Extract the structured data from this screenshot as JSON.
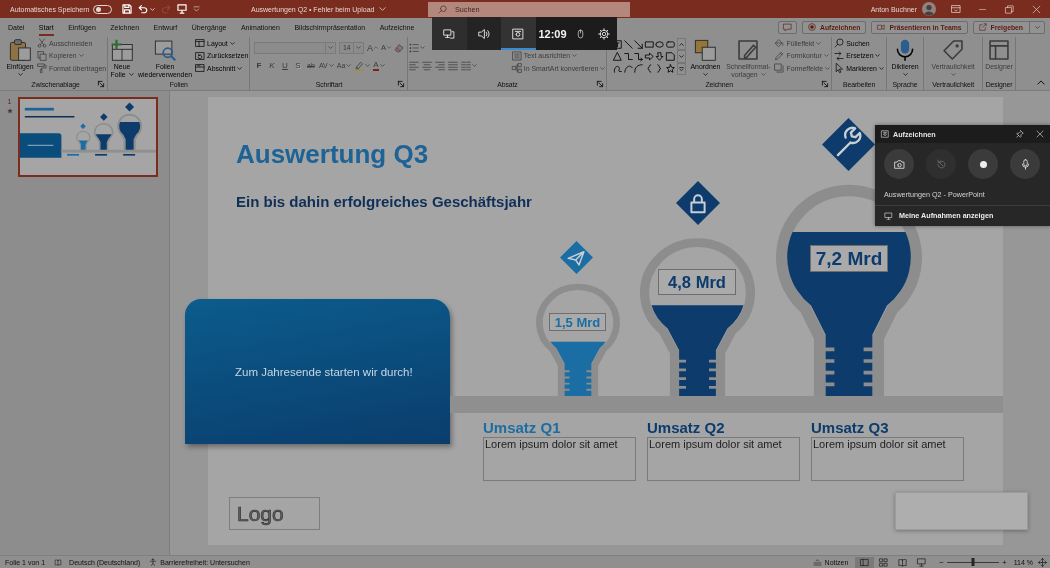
{
  "title_bar": {
    "autosave": {
      "label": "Automatisches Speichern",
      "on": false
    },
    "quick_access": [
      {
        "disabled": false
      },
      {
        "disabled": false
      },
      {
        "disabled": true
      },
      {
        "disabled": false
      }
    ],
    "document_title": "Auswertungen Q2 • Fehler beim Upload",
    "search": {
      "placeholder": "Suchen"
    },
    "user": "Anton Buchner"
  },
  "tabs": [
    {
      "label": "Datei",
      "selected": false
    },
    {
      "label": "Start",
      "selected": true
    },
    {
      "label": "Einfügen",
      "selected": false
    },
    {
      "label": "Zeichnen",
      "selected": false
    },
    {
      "label": "Entwurf",
      "selected": false
    },
    {
      "label": "Übergänge",
      "selected": false
    },
    {
      "label": "Animationen",
      "selected": false
    },
    {
      "label": "Bildschirmpräsentation",
      "selected": false
    },
    {
      "label": "Aufzeichne",
      "selected": false
    }
  ],
  "tab_actions": [
    {
      "label": "Aufzeichnen",
      "menu": false
    },
    {
      "label": "Präsentieren in Teams",
      "menu": false
    },
    {
      "label": "Freigeben",
      "menu": true
    }
  ],
  "ribbon": {
    "groups": [
      {
        "label": "Zwischenablage",
        "launcher": true,
        "items": [
          {
            "kind": "large",
            "label": "Einfügen",
            "menu": true,
            "disabled": false
          },
          {
            "kind": "small",
            "label": "Ausschneiden",
            "menu": false,
            "disabled": true
          },
          {
            "kind": "small",
            "label": "Kopieren",
            "menu": true,
            "disabled": true
          },
          {
            "kind": "small",
            "label": "Format übertragen",
            "menu": false,
            "disabled": true
          }
        ]
      },
      {
        "label": "Folien",
        "launcher": false,
        "items": [
          {
            "kind": "large",
            "label": "Neue Folie",
            "menu": true,
            "disabled": false
          },
          {
            "kind": "large",
            "label": "Folien wiederverwenden",
            "menu": false,
            "disabled": false
          },
          {
            "kind": "small",
            "label": "Layout",
            "menu": true,
            "disabled": false
          },
          {
            "kind": "small",
            "label": "Zurücksetzen",
            "menu": false,
            "disabled": false
          },
          {
            "kind": "small",
            "label": "Abschnitt",
            "menu": true,
            "disabled": false
          }
        ]
      },
      {
        "label": "Schriftart",
        "launcher": true,
        "items": [
          {
            "kind": "toolrow",
            "tools": [
              {
                "kind": "combo",
                "menu": true,
                "disabled": true
              },
              {
                "kind": "combo",
                "value": "14",
                "menu": true,
                "disabled": true
              },
              {
                "kind": "tool",
                "label": "A",
                "menu": false,
                "disabled": true
              },
              {
                "kind": "tool",
                "label": "A",
                "menu": false,
                "disabled": true
              },
              {
                "kind": "tool",
                "menu": false,
                "disabled": true
              }
            ]
          },
          {
            "kind": "toolrow",
            "tools": [
              {
                "kind": "tool",
                "label": "F",
                "menu": false,
                "disabled": true
              },
              {
                "kind": "tool",
                "label": "K",
                "menu": false,
                "disabled": true
              },
              {
                "kind": "tool",
                "label": "U",
                "menu": false,
                "disabled": true
              },
              {
                "kind": "tool",
                "label": "S",
                "menu": false,
                "disabled": true
              },
              {
                "kind": "tool",
                "label": "ab",
                "menu": false,
                "disabled": true
              },
              {
                "kind": "tool",
                "label": "AV",
                "menu": true,
                "disabled": true
              },
              {
                "kind": "tool",
                "label": "Aa",
                "menu": true,
                "disabled": true
              },
              {
                "kind": "tool",
                "menu": true,
                "disabled": true
              },
              {
                "kind": "tool",
                "label": "A",
                "menu": true,
                "disabled": true
              }
            ]
          }
        ]
      },
      {
        "label": "Absatz",
        "launcher": true,
        "items": [
          {
            "kind": "toolrow",
            "tools": [
              {
                "kind": "tool",
                "menu": true,
                "disabled": true
              }
            ]
          },
          {
            "kind": "toolrow",
            "tools": [
              {
                "kind": "tool",
                "menu": false,
                "disabled": true
              },
              {
                "kind": "tool",
                "menu": false,
                "disabled": true
              },
              {
                "kind": "tool",
                "menu": false,
                "disabled": true
              },
              {
                "kind": "tool",
                "menu": false,
                "disabled": true
              },
              {
                "kind": "tool",
                "menu": true,
                "disabled": true
              }
            ]
          },
          {
            "kind": "small",
            "label": "Text ausrichten",
            "menu": true,
            "disabled": true
          },
          {
            "kind": "small",
            "label": "In SmartArt konvertieren",
            "menu": true,
            "disabled": true
          }
        ]
      },
      {
        "label": "Zeichnen",
        "launcher": true,
        "items": [
          {
            "kind": "gallery"
          },
          {
            "kind": "large",
            "label": "Anordnen",
            "menu": true,
            "disabled": false
          },
          {
            "kind": "large",
            "label": "Schnellformat-vorlagen",
            "menu": true,
            "disabled": true
          },
          {
            "kind": "small",
            "label": "Fülleffekt",
            "menu": true,
            "disabled": true
          },
          {
            "kind": "small",
            "label": "Formkontur",
            "menu": true,
            "disabled": true
          },
          {
            "kind": "small",
            "label": "Formeffekte",
            "menu": true,
            "disabled": true
          }
        ]
      },
      {
        "label": "Bearbeiten",
        "launcher": false,
        "items": [
          {
            "kind": "small",
            "label": "Suchen",
            "menu": false,
            "disabled": false
          },
          {
            "kind": "small",
            "label": "Ersetzen",
            "menu": true,
            "disabled": false
          },
          {
            "kind": "small",
            "label": "Markieren",
            "menu": true,
            "disabled": false
          }
        ]
      },
      {
        "label": "Sprache",
        "launcher": false,
        "items": [
          {
            "kind": "large",
            "label": "Diktieren",
            "menu": true,
            "disabled": false
          }
        ]
      },
      {
        "label": "Vertraulichkeit",
        "launcher": false,
        "items": [
          {
            "kind": "large",
            "label": "Vertraulichkeit",
            "menu": true,
            "disabled": true
          }
        ]
      },
      {
        "label": "Designer",
        "launcher": false,
        "items": [
          {
            "kind": "large",
            "label": "Designer",
            "menu": false,
            "disabled": true
          }
        ]
      }
    ]
  },
  "slides_pane": {
    "slides": [
      {
        "number": "1",
        "selected": true
      }
    ]
  },
  "slide": {
    "title": "Auswertung Q3",
    "subtitle": "Ein bis dahin erfolgreiches Geschäftsjahr",
    "callout": "Zum Jahresende starten wir durch!",
    "columns": [
      {
        "value": "1,5 Mrd",
        "level": 0.48,
        "color": "#1b6ea3",
        "heading": "Umsatz Q1",
        "text": "Lorem ipsum dolor sit amet"
      },
      {
        "value": "4,8 Mrd",
        "level": 0.57,
        "color": "#0c3b6c",
        "heading": "Umsatz Q2",
        "text": "Lorem ipsum dolor sit amet"
      },
      {
        "value": "7,2 Mrd",
        "level": 0.77,
        "color": "#0c3b6c",
        "heading": "Umsatz Q3",
        "text": "Lorem ipsum dolor sit amet"
      }
    ],
    "logo": "Logo"
  },
  "status_bar": {
    "slide_info": "Folie 1 von 1",
    "language": "Deutsch (Deutschland)",
    "accessibility": "Barrierefreiheit: Untersuchen",
    "notes": "Notizen",
    "views": [
      {
        "selected": true
      },
      {
        "selected": false
      },
      {
        "selected": false
      },
      {
        "selected": false
      }
    ],
    "zoom": {
      "minus": "−",
      "level": 0.5,
      "plus": "+",
      "value": "114 %"
    }
  },
  "game_bar": {
    "widgets": [
      {
        "selected": false
      },
      {
        "selected": false
      },
      {
        "selected": true
      }
    ],
    "clock": "12:09"
  },
  "capture_widget": {
    "title": "Aufzeichnen",
    "buttons": [
      {
        "disabled": false
      },
      {
        "disabled": true
      },
      {
        "disabled": false
      },
      {
        "disabled": false
      }
    ],
    "source": "Auswertungen Q2 - PowerPoint",
    "link": "Meine Aufnahmen anzeigen"
  }
}
